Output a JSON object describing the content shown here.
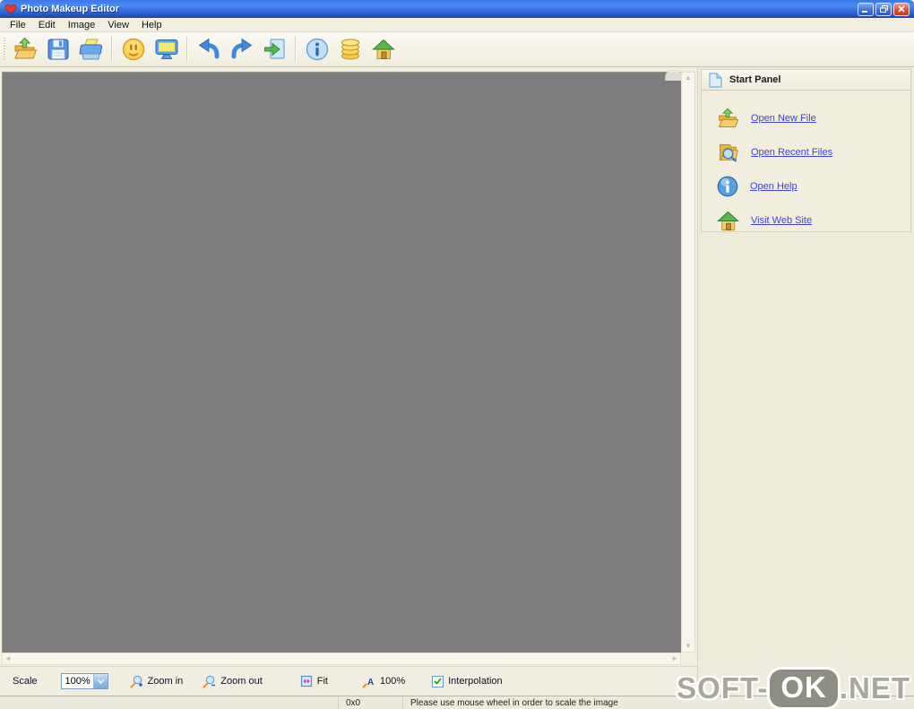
{
  "window": {
    "title": "Photo Makeup Editor",
    "controls": [
      {
        "name": "minimize"
      },
      {
        "name": "restore"
      },
      {
        "name": "close"
      }
    ]
  },
  "menu_bar": {
    "items": [
      "File",
      "Edit",
      "Image",
      "View",
      "Help"
    ]
  },
  "toolbar": {
    "buttons": [
      {
        "name": "open-file"
      },
      {
        "name": "save"
      },
      {
        "name": "print"
      },
      {
        "name": "makeup-smiley"
      },
      {
        "name": "display-preview"
      },
      {
        "name": "undo"
      },
      {
        "name": "redo"
      },
      {
        "name": "export-image"
      },
      {
        "name": "info"
      },
      {
        "name": "buy-coins"
      },
      {
        "name": "home-website"
      }
    ]
  },
  "start_panel": {
    "title": "Start Panel",
    "links": [
      {
        "icon": "open-new-file-icon",
        "label": "Open New File"
      },
      {
        "icon": "open-recent-files-icon",
        "label": "Open Recent Files"
      },
      {
        "icon": "open-help-icon",
        "label": "Open Help"
      },
      {
        "icon": "visit-web-site-icon",
        "label": "Visit Web Site"
      }
    ]
  },
  "zoom_toolbar": {
    "scale_label": "Scale",
    "scale_value": "100%",
    "buttons": [
      {
        "id": "zoom-in",
        "label": "Zoom in"
      },
      {
        "id": "zoom-out",
        "label": "Zoom out"
      },
      {
        "id": "fit",
        "label": "Fit"
      },
      {
        "id": "zoom-100",
        "label": "100%"
      }
    ],
    "interpolation": {
      "label": "Interpolation",
      "checked": true
    }
  },
  "status_bar": {
    "dimensions": "0x0",
    "message": "Please use mouse wheel in order to scale the image"
  },
  "watermark": {
    "prefix": "SOFT-",
    "badge": "OK",
    "suffix": ".NET"
  },
  "colors": {
    "titlebar_blue": "#2f63d6",
    "close_red": "#dd4f35",
    "canvas_gray": "#7d7d7d",
    "panel_cream": "#eeebdc",
    "link_blue": "#4242d6",
    "check_green": "#28a828"
  }
}
